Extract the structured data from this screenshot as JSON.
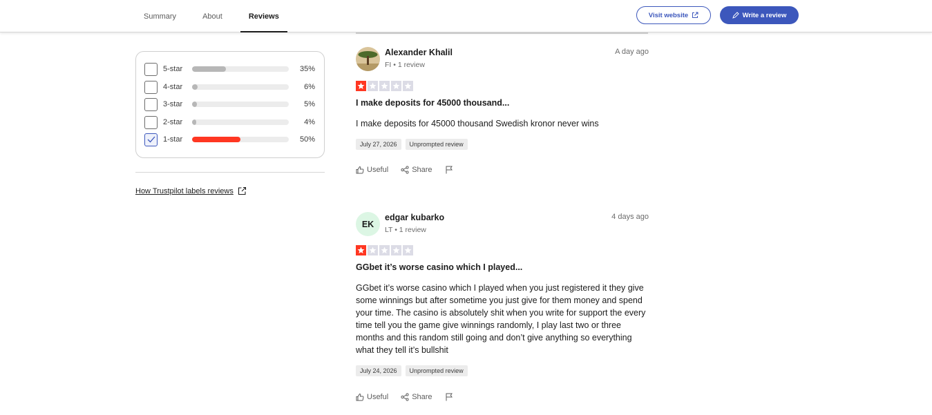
{
  "nav": {
    "tabs": [
      {
        "label": "Summary",
        "active": false
      },
      {
        "label": "About",
        "active": false
      },
      {
        "label": "Reviews",
        "active": true
      }
    ],
    "visit_label": "Visit website",
    "write_label": "Write a review",
    "accent_color": "#3c57bc"
  },
  "filters": {
    "rows": [
      {
        "label": "5-star",
        "percent": "35%",
        "fill_fraction": 0.35,
        "checked": false
      },
      {
        "label": "4-star",
        "percent": "6%",
        "fill_fraction": 0.06,
        "checked": false
      },
      {
        "label": "3-star",
        "percent": "5%",
        "fill_fraction": 0.05,
        "checked": false
      },
      {
        "label": "2-star",
        "percent": "4%",
        "fill_fraction": 0.04,
        "checked": false
      },
      {
        "label": "1-star",
        "percent": "50%",
        "fill_fraction": 0.5,
        "checked": true
      }
    ],
    "labels_link": "How Trustpilot labels reviews",
    "star_color": "#ff3722"
  },
  "reviews": [
    {
      "name": "Alexander Khalil",
      "meta": "FI • 1 review",
      "date": "A day ago",
      "rating": 1,
      "title": "I make deposits for 45000 thousand...",
      "body": "I make deposits for 45000 thousand Swedish kronor never wins",
      "experience_date": "July 27, 2026",
      "tag": "Unprompted review",
      "useful": "Useful",
      "share": "Share",
      "avatar": "tree-photo-avatar"
    },
    {
      "name": "edgar kubarko",
      "initials": "EK",
      "meta": "LT • 1 review",
      "date": "4 days ago",
      "rating": 1,
      "title": "GGbet it’s worse casino which I played...",
      "body": "GGbet it’s worse casino which I played when you just registered it they give some winnings but after sometime you just give for them money and spend your time. The casino is absolutely shit when you write for support the every time tell you the game give winnings randomly, I play last two or three months and this random still going and don’t give anything so everything what they tell it’s bullshit",
      "experience_date": "July 24, 2026",
      "tag": "Unprompted review",
      "useful": "Useful",
      "share": "Share"
    }
  ]
}
